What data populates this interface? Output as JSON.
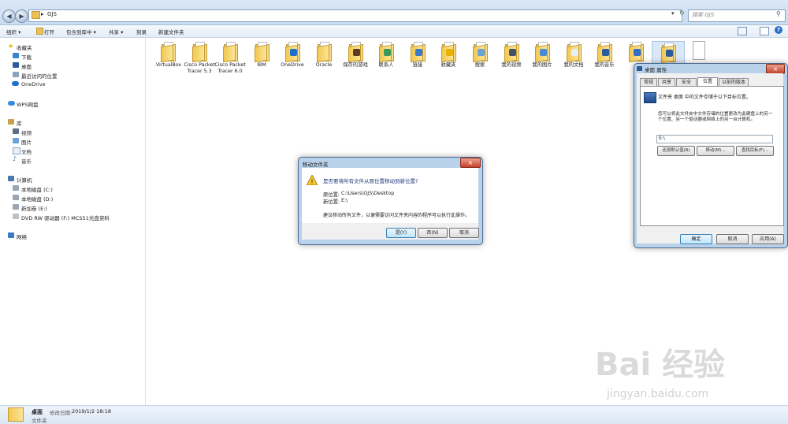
{
  "address": {
    "path": "GJS",
    "path_sep": "▸",
    "search_placeholder": "搜索 GJS"
  },
  "toolbar": {
    "items": [
      "组织 ▾",
      "打开",
      "包含到库中 ▾",
      "共享 ▾",
      "刻录",
      "新建文件夹"
    ]
  },
  "nav": {
    "favorites": {
      "label": "收藏夹",
      "items": [
        "下载",
        "桌面",
        "最近访问的位置"
      ]
    },
    "onedrive": "OneDrive",
    "wps": "WPS网盘",
    "library": {
      "label": "库",
      "items": [
        "视频",
        "图片",
        "文档",
        "音乐"
      ]
    },
    "computer": {
      "label": "计算机",
      "items": [
        "本地磁盘 (C:)",
        "本地磁盘 (D:)",
        "新加卷 (E:)",
        "DVD RW 驱动器 (F:) MCS51光盘资料"
      ]
    },
    "network": "网络"
  },
  "files": [
    {
      "name": ".VirtualBox"
    },
    {
      "name": "Cisco Packet Tracer 5.3"
    },
    {
      "name": "Cisco Packet Tracer 6.0"
    },
    {
      "name": "IBM"
    },
    {
      "name": "OneDrive"
    },
    {
      "name": "Oracle"
    },
    {
      "name": "保存的游戏"
    },
    {
      "name": "联系人"
    },
    {
      "name": "链接"
    },
    {
      "name": "收藏夹"
    },
    {
      "name": "搜索"
    },
    {
      "name": "我的视频"
    },
    {
      "name": "我的图片"
    },
    {
      "name": "我的文档"
    },
    {
      "name": "我的音乐"
    },
    {
      "name": ""
    },
    {
      "name": ""
    },
    {
      "name": ""
    }
  ],
  "status": {
    "name": "桌面",
    "modified_label": "修改日期:",
    "modified": "2019/1/2 18:18",
    "type": "文件夹"
  },
  "move_dialog": {
    "title": "移动文件夹",
    "question": "是否要将所有文件从原位置移动到新位置?",
    "from_label": "原位置:",
    "from": "C:\\Users\\GJS\\Desktop",
    "to_label": "新位置:",
    "to": "E:\\",
    "advice": "建议移动所有文件，以便需要访问文件夹内容的程序可以执行此操作。",
    "yes": "是(Y)",
    "no": "否(N)",
    "cancel": "取消"
  },
  "props_dialog": {
    "title": "桌面 属性",
    "tabs": [
      "常规",
      "共享",
      "安全",
      "位置",
      "以前的版本"
    ],
    "active_tab": "位置",
    "desc": "文件夹 桌面 中的文件存储于以下目标位置。",
    "hint": "您可以将此文件夹中文件存储的位置更改为此硬盘上的另一个位置、另一个驱动器或网络上的另一台计算机。",
    "path": "E:\\",
    "restore": "还原默认值(R)",
    "move": "移动(M)...",
    "find": "查找目标(F)...",
    "ok": "确定",
    "cancel": "取消",
    "apply": "应用(A)"
  },
  "watermark": {
    "main": "Bai 经验",
    "sub": "jingyan.baidu.com"
  }
}
